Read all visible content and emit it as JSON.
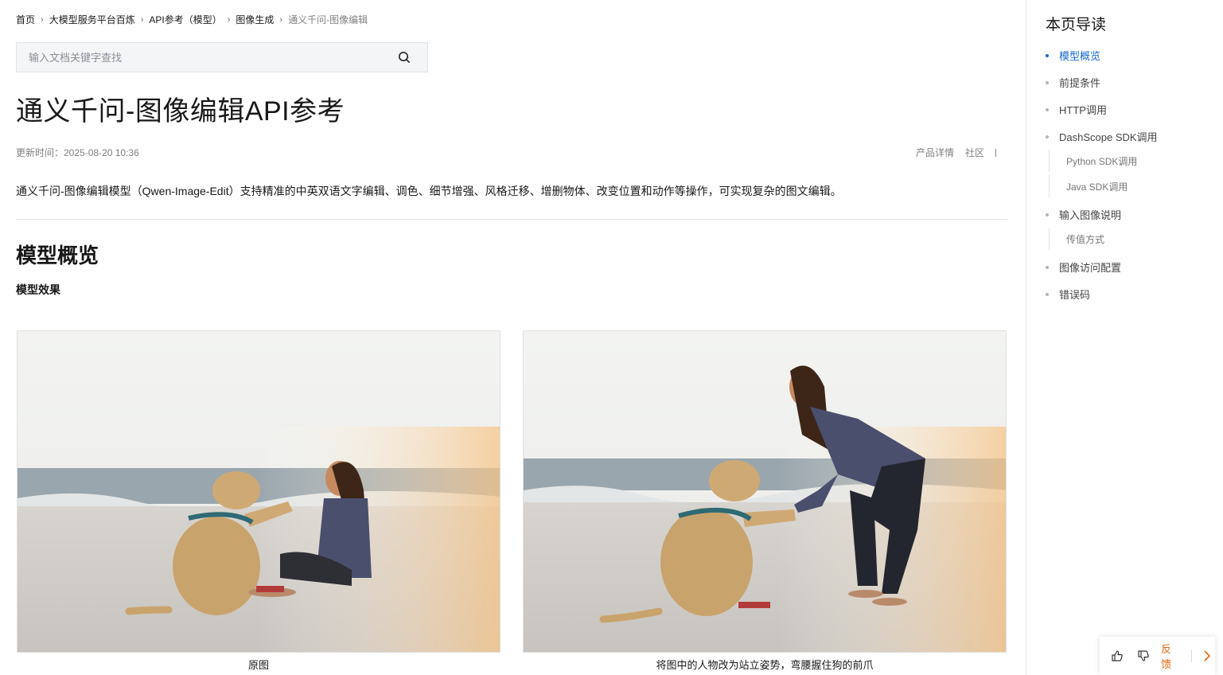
{
  "breadcrumb": {
    "items": [
      "首页",
      "大模型服务平台百炼",
      "API参考（模型）",
      "图像生成"
    ],
    "current": "通义千问-图像编辑"
  },
  "search": {
    "placeholder": "输入文档关键字查找",
    "icon": "search-icon"
  },
  "article": {
    "title": "通义千问-图像编辑API参考",
    "updated": "更新时间：2025-08-20 10:36",
    "links": [
      "产品详情",
      "社区"
    ],
    "intro": "通义千问-图像编辑模型（Qwen-Image-Edit）支持精准的中英双语文字编辑、调色、细节增强、风格迁移、增删物体、改变位置和动作等操作，可实现复杂的图文编辑。",
    "section_title": "模型概览",
    "subsection_title": "模型效果",
    "figures": [
      {
        "caption": "原图"
      },
      {
        "caption": "将图中的人物改为站立姿势，弯腰握住狗的前爪"
      }
    ]
  },
  "toc": {
    "title": "本页导读",
    "items": [
      {
        "label": "模型概览",
        "active": true
      },
      {
        "label": "前提条件"
      },
      {
        "label": "HTTP调用"
      },
      {
        "label": "DashScope SDK调用"
      },
      {
        "label": "Python SDK调用",
        "sub": true
      },
      {
        "label": "Java SDK调用",
        "sub": true
      },
      {
        "label": "输入图像说明"
      },
      {
        "label": "传值方式",
        "sub": true
      },
      {
        "label": "图像访问配置"
      },
      {
        "label": "错误码"
      }
    ]
  },
  "feedback": {
    "label": "反馈",
    "like_icon": "thumbs-up-icon",
    "dislike_icon": "thumbs-down-icon",
    "expand_icon": "chevron-right-icon"
  },
  "colors": {
    "accent": "#1967d2",
    "feedback": "#e8660c"
  }
}
